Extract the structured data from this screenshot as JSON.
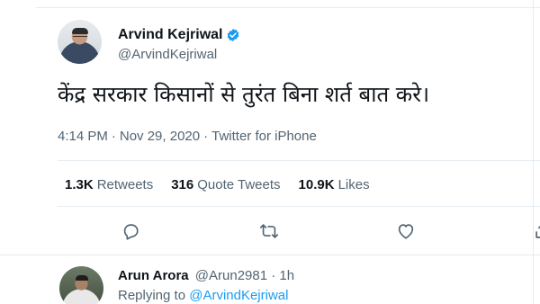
{
  "tweet": {
    "author": {
      "name": "Arvind Kejriwal",
      "handle": "@ArvindKejriwal",
      "verified": true
    },
    "text": "केंद्र सरकार किसानों से तुरंत बिना शर्त बात करे।",
    "time": "4:14 PM",
    "date": "Nov 29, 2020",
    "source": "Twitter for iPhone",
    "separator": "·",
    "stats": [
      {
        "value": "1.3K",
        "label": "Retweets"
      },
      {
        "value": "316",
        "label": "Quote Tweets"
      },
      {
        "value": "10.9K",
        "label": "Likes"
      }
    ],
    "actions": [
      "reply-icon",
      "retweet-icon",
      "like-icon",
      "share-icon"
    ]
  },
  "reply": {
    "name": "Arun Arora",
    "handle": "@Arun2981",
    "separator": "·",
    "age": "1h",
    "replying_prefix": "Replying to",
    "replying_to": "@ArvindKejriwal"
  },
  "colors": {
    "accent": "#1d9bf0",
    "text": "#0f1419",
    "secondary": "#536471",
    "border": "#e6ecf0"
  }
}
